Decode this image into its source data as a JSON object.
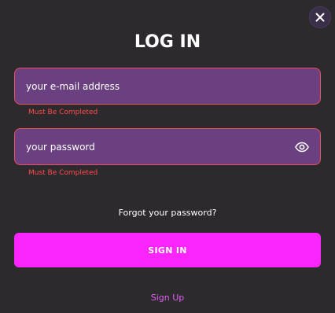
{
  "modal": {
    "title": "LOG IN",
    "close_icon": "close-icon"
  },
  "form": {
    "email": {
      "placeholder": "your e-mail address",
      "value": "",
      "error": "Must Be Completed"
    },
    "password": {
      "placeholder": "your password",
      "value": "",
      "error": "Must Be Completed",
      "toggle_icon": "eye-icon"
    },
    "forgot_password_label": "Forgot your password?",
    "submit_label": "SIGN IN",
    "signup_label": "Sign Up"
  },
  "colors": {
    "background": "#2d2a2e",
    "field_background": "#6a4080",
    "field_border_error": "#e8505a",
    "error_text": "#ff4a4a",
    "primary_button": "#fb25fb",
    "link_accent": "#e060f0"
  }
}
